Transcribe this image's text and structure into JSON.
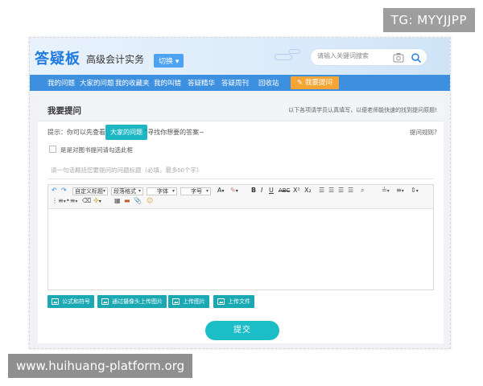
{
  "badge": "TG: MYYJJPP",
  "watermark": "www.huihuang-platform.org",
  "header": {
    "logo": "答疑板",
    "course": "高级会计实务",
    "switch_label": "切换",
    "search_placeholder": "请输入关键词搜索"
  },
  "nav": {
    "items": [
      "我的问题",
      "大家的问题",
      "我的收藏夹",
      "我的叫错",
      "答疑精华",
      "答疑周刊",
      "回收站"
    ],
    "ask_label": "我要提问"
  },
  "main": {
    "title": "我要提问",
    "hint_right": "以下各项请学员认真填写，以便老师能快速的找到提问原题!",
    "tip_prefix": "提示：你可以先查看“",
    "tip_link": "大家的问题",
    "tip_suffix": "”寻找你想要的答案~",
    "help_link": "提问规则?",
    "checkbox_label": "是是对图书提问请勾选此框",
    "title_placeholder": "请一句话概括您要提问的问题标题（必填，最多50个字）",
    "toolbar": {
      "custom_title": "自定义标题",
      "para_format": "段落格式",
      "font": "字体",
      "font_size": "字号"
    },
    "uploads": [
      "公式和符号",
      "通过摄像头上传图片",
      "上传图片",
      "上传文件"
    ],
    "submit_label": "提交"
  },
  "colors": {
    "nav_bg": "#3d8fe0",
    "accent_orange": "#f5a533",
    "accent_teal": "#1bbdc6"
  }
}
